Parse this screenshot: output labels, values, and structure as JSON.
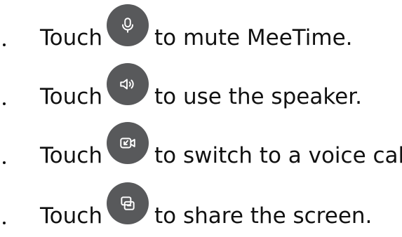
{
  "instructions": [
    {
      "touch": "Touch",
      "icon": "microphone-icon",
      "text": "to mute MeeTime."
    },
    {
      "touch": "Touch",
      "icon": "speaker-icon",
      "text": "to use the speaker."
    },
    {
      "touch": "Touch",
      "icon": "switch-to-voice-call-icon",
      "text": "to switch to a voice call."
    },
    {
      "touch": "Touch",
      "icon": "share-screen-icon",
      "text": "to share the screen."
    }
  ],
  "colors": {
    "icon_background": "#58595b",
    "icon_foreground": "#ffffff",
    "text": "#111111"
  }
}
